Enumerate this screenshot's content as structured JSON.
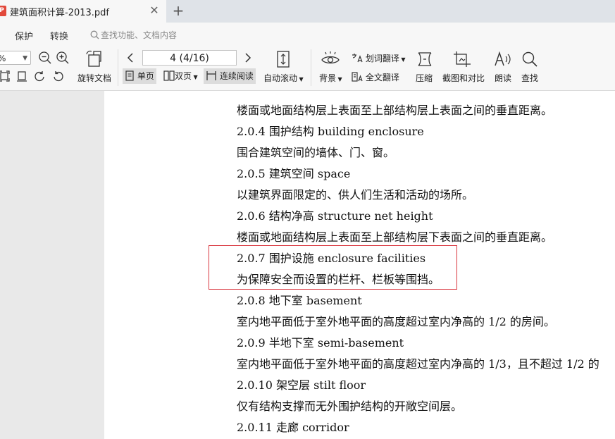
{
  "tab": {
    "title": "建筑面积计算-2013.pdf",
    "badge": "P",
    "close": "✕",
    "new": "+"
  },
  "menu": {
    "protect": "保护",
    "convert": "转换",
    "search_placeholder": "查找功能、文档内容"
  },
  "toolbar": {
    "zoom_value": "%",
    "rotate_label": "旋转文档",
    "page_value": "4 (4/16)",
    "single_page": "单页",
    "double_page": "双页",
    "continuous": "连续阅读",
    "auto_scroll": "自动滚动",
    "background": "背景",
    "word_translate": "划词翻译",
    "full_translate": "全文翻译",
    "compress": "压缩",
    "screenshot_compare": "截图和对比",
    "read_aloud": "朗读",
    "find": "查找"
  },
  "document": {
    "lines": [
      "楼面或地面结构层上表面至上部结构层上表面之间的垂直距离。",
      "2.0.4  围护结构  building enclosure",
      "围合建筑空间的墙体、门、窗。",
      "2.0.5  建筑空间  space",
      "以建筑界面限定的、供人们生活和活动的场所。",
      "2.0.6  结构净高  structure net height",
      "楼面或地面结构层上表面至上部结构层下表面之间的垂直距离。",
      "2.0.7  围护设施  enclosure facilities",
      "为保障安全而设置的栏杆、栏板等围挡。",
      "2.0.8  地下室  basement",
      "室内地平面低于室外地平面的高度超过室内净高的 1/2 的房间。",
      "2.0.9  半地下室  semi-basement",
      "室内地平面低于室外地平面的高度超过室内净高的 1/3，且不超过 1/2 的",
      "2.0.10  架空层  stilt floor",
      "仅有结构支撑而无外围护结构的开敞空间层。",
      "2.0.11  走廊  corridor"
    ]
  },
  "colors": {
    "highlight_box": "#d9363e",
    "pdf_badge": "#e2493b"
  }
}
